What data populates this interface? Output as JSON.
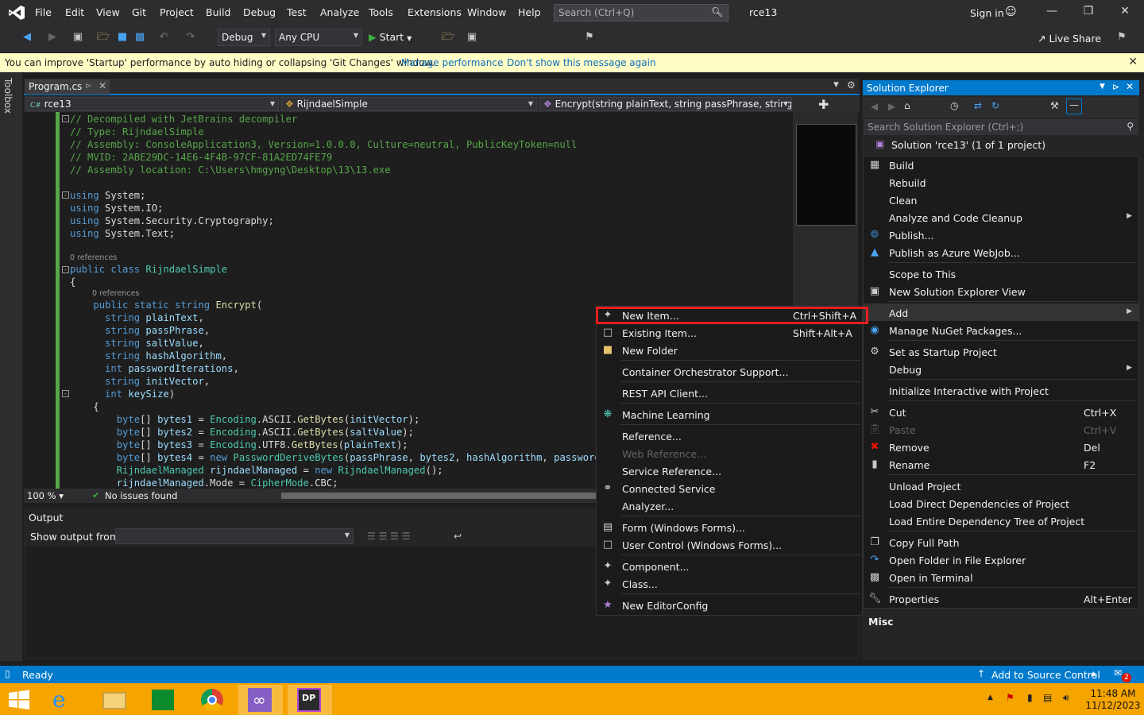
{
  "menu": {
    "items": [
      "File",
      "Edit",
      "View",
      "Git",
      "Project",
      "Build",
      "Debug",
      "Test",
      "Analyze",
      "Tools",
      "Extensions",
      "Window",
      "Help"
    ],
    "search_placeholder": "Search (Ctrl+Q)",
    "solution_name": "rce13",
    "sign_in": "Sign in"
  },
  "toolbar": {
    "config": "Debug",
    "platform": "Any CPU",
    "start": "Start",
    "live_share": "Live Share"
  },
  "infobar": {
    "message": "You can improve 'Startup' performance by auto hiding or collapsing 'Git Changes' window.",
    "link1": "Manage performance",
    "link2": "Don't show this message again"
  },
  "toolbox_label": "Toolbox",
  "editor": {
    "tab": "Program.cs",
    "nav_project": "rce13",
    "nav_class": "RijndaelSimple",
    "nav_member": "Encrypt(string plainText, string passPhrase, string saltV",
    "zoom": "100 %",
    "issues": "No issues found",
    "references": "0 references"
  },
  "output": {
    "title": "Output",
    "show_from": "Show output from:"
  },
  "solution_explorer": {
    "title": "Solution Explorer",
    "search_placeholder": "Search Solution Explorer (Ctrl+;)",
    "solution_label": "Solution 'rce13' (1 of 1 project)",
    "misc": "Misc"
  },
  "context_menu": {
    "items": [
      {
        "label": "Build",
        "shortcut": "",
        "icon": "build-icon"
      },
      {
        "label": "Rebuild",
        "shortcut": ""
      },
      {
        "label": "Clean",
        "shortcut": ""
      },
      {
        "label": "Analyze and Code Cleanup",
        "shortcut": "",
        "submenu": true
      },
      {
        "label": "Publish...",
        "shortcut": "",
        "icon": "globe-icon"
      },
      {
        "label": "Publish as Azure WebJob...",
        "shortcut": "",
        "icon": "azure-icon"
      },
      {
        "label": "Scope to This",
        "shortcut": ""
      },
      {
        "label": "New Solution Explorer View",
        "shortcut": "",
        "icon": "new-view-icon"
      },
      {
        "label": "Add",
        "shortcut": "",
        "submenu": true
      },
      {
        "label": "Manage NuGet Packages...",
        "shortcut": "",
        "icon": "nuget-icon"
      },
      {
        "label": "Set as Startup Project",
        "shortcut": "",
        "icon": "gear-icon"
      },
      {
        "label": "Debug",
        "shortcut": "",
        "submenu": true
      },
      {
        "label": "Initialize Interactive with Project",
        "shortcut": ""
      },
      {
        "label": "Cut",
        "shortcut": "Ctrl+X",
        "icon": "scissors-icon"
      },
      {
        "label": "Paste",
        "shortcut": "Ctrl+V",
        "disabled": true,
        "icon": "paste-icon"
      },
      {
        "label": "Remove",
        "shortcut": "Del",
        "icon": "remove-icon"
      },
      {
        "label": "Rename",
        "shortcut": "F2",
        "icon": "rename-icon"
      },
      {
        "label": "Unload Project",
        "shortcut": ""
      },
      {
        "label": "Load Direct Dependencies of Project",
        "shortcut": ""
      },
      {
        "label": "Load Entire Dependency Tree of Project",
        "shortcut": ""
      },
      {
        "label": "Copy Full Path",
        "shortcut": "",
        "icon": "copy-icon"
      },
      {
        "label": "Open Folder in File Explorer",
        "shortcut": "",
        "icon": "open-folder-icon"
      },
      {
        "label": "Open in Terminal",
        "shortcut": "",
        "icon": "terminal-icon"
      },
      {
        "label": "Properties",
        "shortcut": "Alt+Enter",
        "icon": "wrench-icon"
      }
    ]
  },
  "add_submenu": {
    "items": [
      {
        "label": "New Item...",
        "shortcut": "Ctrl+Shift+A"
      },
      {
        "label": "Existing Item...",
        "shortcut": "Shift+Alt+A"
      },
      {
        "label": "New Folder",
        "shortcut": ""
      },
      {
        "label": "Container Orchestrator Support...",
        "shortcut": ""
      },
      {
        "label": "REST API Client...",
        "shortcut": ""
      },
      {
        "label": "Machine Learning",
        "shortcut": ""
      },
      {
        "label": "Reference...",
        "shortcut": ""
      },
      {
        "label": "Web Reference...",
        "shortcut": "",
        "disabled": true
      },
      {
        "label": "Service Reference...",
        "shortcut": ""
      },
      {
        "label": "Connected Service",
        "shortcut": ""
      },
      {
        "label": "Analyzer...",
        "shortcut": ""
      },
      {
        "label": "Form (Windows Forms)...",
        "shortcut": ""
      },
      {
        "label": "User Control (Windows Forms)...",
        "shortcut": ""
      },
      {
        "label": "Component...",
        "shortcut": ""
      },
      {
        "label": "Class...",
        "shortcut": ""
      },
      {
        "label": "New EditorConfig",
        "shortcut": ""
      }
    ]
  },
  "statusbar": {
    "ready": "Ready",
    "source_control": "Add to Source Control",
    "notifications": "2"
  },
  "taskbar": {
    "time": "11:48 AM",
    "date": "11/12/2023"
  },
  "code": {
    "c1": "// Decompiled with JetBrains decompiler",
    "c2": "// Type: RijndaelSimple",
    "c3": "// Assembly: ConsoleApplication3, Version=1.0.0.0, Culture=neutral, PublicKeyToken=null",
    "c4": "// MVID: 2ABE29DC-14E6-4F4B-97CF-81A2ED74FE79",
    "c5": "// Assembly location: C:\\Users\\hmgyng\\Desktop\\13\\13.exe"
  }
}
